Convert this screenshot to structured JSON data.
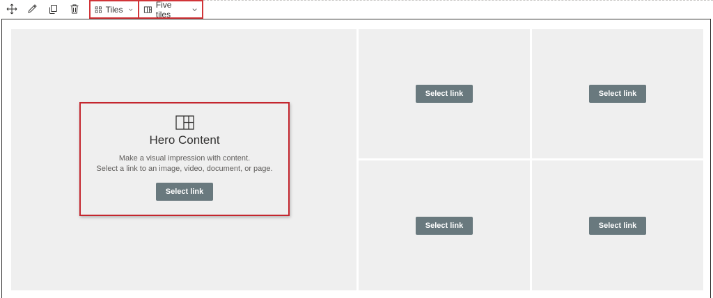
{
  "toolbar": {
    "icons": [
      "move-icon",
      "edit-icon",
      "duplicate-icon",
      "delete-icon"
    ],
    "layout_dropdown": {
      "label": "Tiles",
      "icon": "tiles-icon"
    },
    "tiles_dropdown": {
      "label": "Five tiles",
      "icon": "grid-icon"
    }
  },
  "hero": {
    "icon": "hero-grid-icon",
    "title": "Hero Content",
    "description_line1": "Make a visual impression with content.",
    "description_line2": "Select a link to an image, video, document, or page.",
    "button_label": "Select link"
  },
  "tiles": [
    {
      "button_label": "Select link"
    },
    {
      "button_label": "Select link"
    },
    {
      "button_label": "Select link"
    },
    {
      "button_label": "Select link"
    }
  ],
  "colors": {
    "highlight": "#d13438",
    "button": "#69797e",
    "tile_bg": "#efefef"
  }
}
